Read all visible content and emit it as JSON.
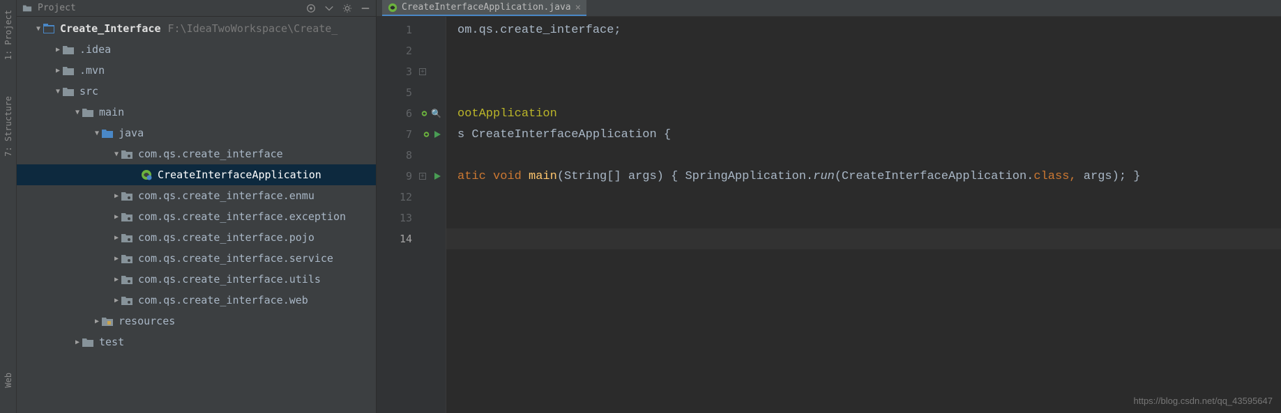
{
  "tool_stripe": {
    "project_label": "1: Project",
    "structure_label": "7: Structure",
    "web_label": "Web"
  },
  "project_panel": {
    "header_title": "Project",
    "root_label": "Create_Interface",
    "root_path": "F:\\IdeaTwoWorkspace\\Create_",
    "tree": [
      {
        "indent": 0,
        "arrow": "expanded",
        "icon": "project",
        "label": "Create_Interface",
        "root": true
      },
      {
        "indent": 1,
        "arrow": "collapsed",
        "icon": "folder",
        "label": ".idea"
      },
      {
        "indent": 1,
        "arrow": "collapsed",
        "icon": "folder",
        "label": ".mvn"
      },
      {
        "indent": 1,
        "arrow": "expanded",
        "icon": "folder",
        "label": "src"
      },
      {
        "indent": 2,
        "arrow": "expanded",
        "icon": "folder",
        "label": "main"
      },
      {
        "indent": 3,
        "arrow": "expanded",
        "icon": "folder-blue",
        "label": "java"
      },
      {
        "indent": 4,
        "arrow": "expanded",
        "icon": "package",
        "label": "com.qs.create_interface"
      },
      {
        "indent": 5,
        "arrow": "none",
        "icon": "spring",
        "label": "CreateInterfaceApplication",
        "selected": true
      },
      {
        "indent": 4,
        "arrow": "collapsed",
        "icon": "package",
        "label": "com.qs.create_interface.enmu"
      },
      {
        "indent": 4,
        "arrow": "collapsed",
        "icon": "package",
        "label": "com.qs.create_interface.exception"
      },
      {
        "indent": 4,
        "arrow": "collapsed",
        "icon": "package",
        "label": "com.qs.create_interface.pojo"
      },
      {
        "indent": 4,
        "arrow": "collapsed",
        "icon": "package",
        "label": "com.qs.create_interface.service"
      },
      {
        "indent": 4,
        "arrow": "collapsed",
        "icon": "package",
        "label": "com.qs.create_interface.utils"
      },
      {
        "indent": 4,
        "arrow": "collapsed",
        "icon": "package",
        "label": "com.qs.create_interface.web"
      },
      {
        "indent": 3,
        "arrow": "collapsed",
        "icon": "resources",
        "label": "resources"
      },
      {
        "indent": 2,
        "arrow": "collapsed",
        "icon": "folder",
        "label": "test"
      }
    ]
  },
  "editor": {
    "tab_label": "CreateInterfaceApplication.java",
    "visible_line_numbers": [
      "1",
      "2",
      "3",
      "5",
      "6",
      "7",
      "8",
      "9",
      "12",
      "13",
      "14"
    ],
    "current_line_index": 10,
    "gutter_icons": {
      "4": "magnify-spring",
      "5": "spring-run",
      "7": "run"
    },
    "fold_lines": [
      2,
      7
    ],
    "code": {
      "l1_text": "om.qs.create_interface;",
      "l6_text": "ootApplication",
      "l7_pre": "s ",
      "l7_class": "CreateInterfaceApplication",
      "l7_post": " {",
      "l9_kw1": "atic",
      "l9_kw2": "void",
      "l9_method": "main",
      "l9_args": "(String[] args) { ",
      "l9_call": "SpringApplication.",
      "l9_run": "run",
      "l9_p1": "(CreateInterfaceApplication.",
      "l9_kw3": "class",
      "l9_p2": ",",
      "l9_args2": " args); }"
    }
  },
  "watermark": "https://blog.csdn.net/qq_43595647"
}
